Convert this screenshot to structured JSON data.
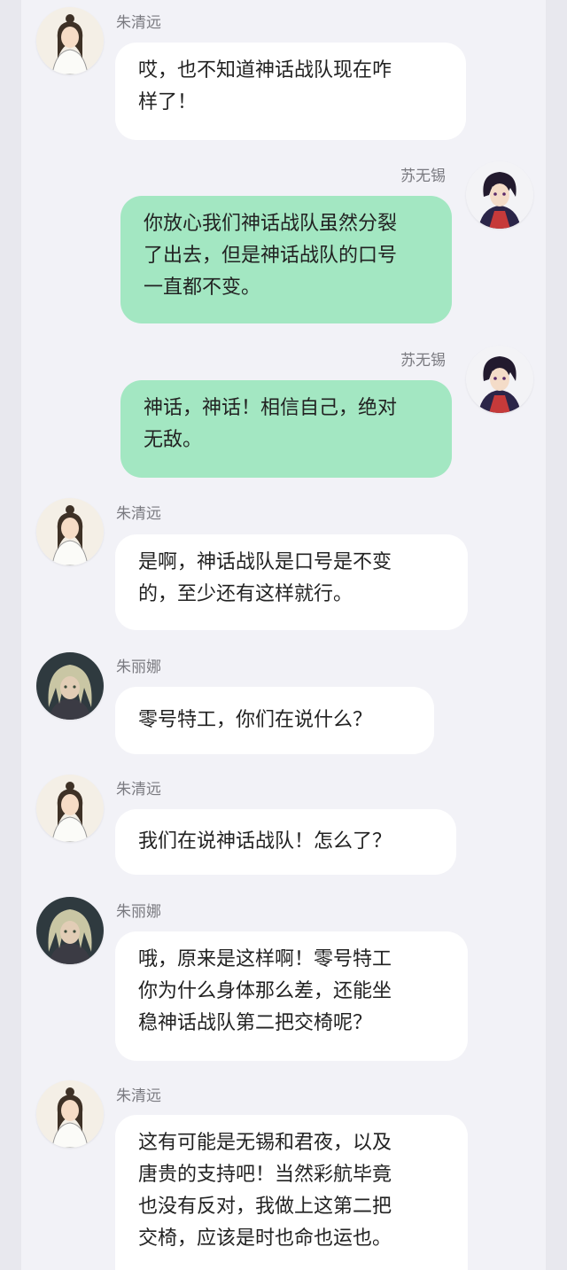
{
  "colors": {
    "background": "#f2f2f7",
    "incoming_bubble": "#ffffff",
    "outgoing_bubble": "#a3e7c2",
    "sender_name": "#7a7a80"
  },
  "messages": [
    {
      "direction": "incoming",
      "sender": "朱清远",
      "avatar_icon": "woman-long-hair-avatar-icon",
      "lines": [
        "哎，也不知道神话战队现在咋",
        "样了！"
      ]
    },
    {
      "direction": "outgoing",
      "sender": "苏无锡",
      "avatar_icon": "dark-hair-anime-avatar-icon",
      "lines": [
        "你放心我们神话战队虽然分裂",
        "了出去，但是神话战队的口号",
        "一直都不变。"
      ]
    },
    {
      "direction": "outgoing",
      "sender": "苏无锡",
      "avatar_icon": "dark-hair-anime-avatar-icon",
      "lines": [
        "神话，神话！相信自己，绝对",
        "无敌。"
      ]
    },
    {
      "direction": "incoming",
      "sender": "朱清远",
      "avatar_icon": "woman-long-hair-avatar-icon",
      "lines": [
        "是啊，神话战队是口号是不变",
        "的，至少还有这样就行。"
      ]
    },
    {
      "direction": "incoming",
      "sender": "朱丽娜",
      "avatar_icon": "blonde-anime-avatar-icon",
      "lines": [
        "零号特工，你们在说什么？"
      ]
    },
    {
      "direction": "incoming",
      "sender": "朱清远",
      "avatar_icon": "woman-long-hair-avatar-icon",
      "lines": [
        "我们在说神话战队！怎么了？"
      ]
    },
    {
      "direction": "incoming",
      "sender": "朱丽娜",
      "avatar_icon": "blonde-anime-avatar-icon",
      "lines": [
        "哦，原来是这样啊！零号特工",
        "你为什么身体那么差，还能坐",
        "稳神话战队第二把交椅呢？"
      ]
    },
    {
      "direction": "incoming",
      "sender": "朱清远",
      "avatar_icon": "woman-long-hair-avatar-icon",
      "lines": [
        "这有可能是无锡和君夜，以及",
        "唐贵的支持吧！当然彩航毕竟",
        "也没有反对，我做上这第二把",
        "交椅，应该是时也命也运也。"
      ]
    }
  ]
}
